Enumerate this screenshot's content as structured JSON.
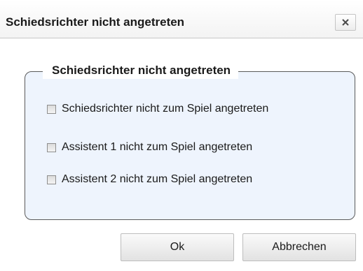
{
  "dialog": {
    "title": "Schiedsrichter nicht angetreten",
    "close_label": "×"
  },
  "group": {
    "legend": "Schiedsrichter nicht angetreten",
    "options": [
      {
        "label": "Schiedsrichter nicht zum Spiel angetreten",
        "checked": false
      },
      {
        "label": "Assistent 1 nicht zum Spiel angetreten",
        "checked": false
      },
      {
        "label": "Assistent 2 nicht zum Spiel angetreten",
        "checked": false
      }
    ]
  },
  "buttons": {
    "ok_label": "Ok",
    "cancel_label": "Abbrechen"
  },
  "colors": {
    "panel_background": "#eef4fd",
    "panel_border": "#5a5a5a"
  }
}
